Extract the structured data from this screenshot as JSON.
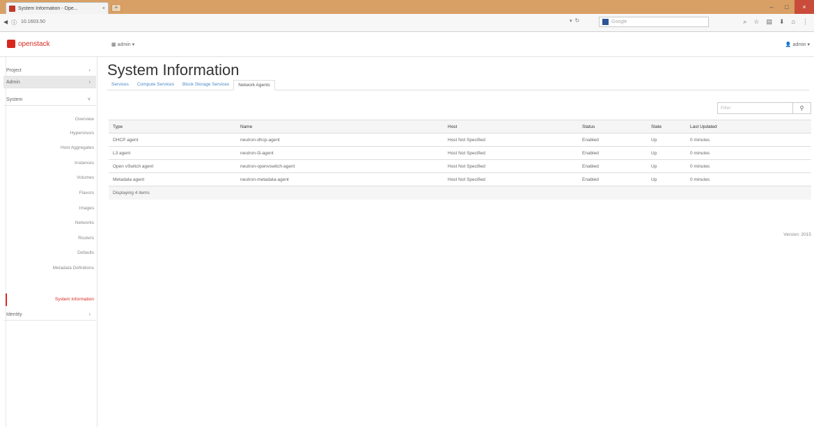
{
  "browser": {
    "tab_title": "System Information - Ope...",
    "tab_close": "×",
    "new_tab": "+",
    "url": "10.1603.50",
    "search_placeholder": "Google",
    "win_minimize": "–",
    "win_maximize": "□",
    "win_close": "×"
  },
  "header": {
    "brand": "openstack",
    "project_menu": "admin ▾",
    "user_menu": "admin ▾"
  },
  "sidebar": {
    "groups": [
      {
        "label": "Project",
        "chevron": "›"
      },
      {
        "label": "Admin",
        "chevron": "›"
      },
      {
        "label": "System",
        "chevron": "˅"
      },
      {
        "label": "Identity",
        "chevron": "›"
      }
    ],
    "items": [
      "Overview",
      "Hypervisors",
      "Host Aggregates",
      "Instances",
      "Volumes",
      "Flavors",
      "Images",
      "Networks",
      "Routers",
      "Defaults",
      "Metadata Definitions",
      "System Information"
    ]
  },
  "main": {
    "title": "System Information",
    "tabs": [
      "Services",
      "Compute Services",
      "Block Storage Services",
      "Network Agents"
    ],
    "filter_placeholder": "Filter",
    "table": {
      "columns": [
        "Type",
        "Name",
        "Host",
        "Status",
        "State",
        "Last Updated"
      ],
      "rows": [
        [
          "DHCP agent",
          "neutron-dhcp-agent",
          "Host Not Specified",
          "Enabled",
          "Up",
          "0 minutes"
        ],
        [
          "L3 agent",
          "neutron-l3-agent",
          "Host Not Specified",
          "Enabled",
          "Up",
          "0 minutes"
        ],
        [
          "Open vSwitch agent",
          "neutron-openvswitch-agent",
          "Host Not Specified",
          "Enabled",
          "Up",
          "0 minutes"
        ],
        [
          "Metadata agent",
          "neutron-metadata-agent",
          "Host Not Specified",
          "Enabled",
          "Up",
          "0 minutes"
        ]
      ],
      "footer": "Displaying 4 items"
    },
    "version": "Version: 2015"
  }
}
